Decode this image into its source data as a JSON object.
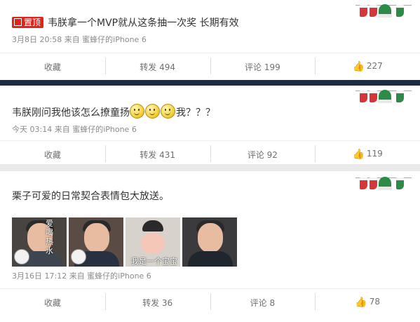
{
  "posts": [
    {
      "pinned_label": "置顶",
      "text": "韦朕拿一个MVP就从这条抽一次奖 长期有效",
      "meta": "3月8日 20:58 来自 蜜蜂仔的iPhone 6",
      "actions": {
        "favorite": "收藏",
        "repost": "转发 494",
        "comment": "评论 199",
        "like": "227"
      }
    },
    {
      "text_before": "韦朕刚问我他该怎么撩童扬",
      "text_after": "我？？？",
      "emoji_count": 3,
      "meta": "今天 03:14 来自 蜜蜂仔的iPhone 6",
      "actions": {
        "favorite": "收藏",
        "repost": "转发 431",
        "comment": "评论 92",
        "like": "119"
      }
    },
    {
      "text": "栗子可爱的日常契合表情包大放送。",
      "photo_captions": [
        "爱喝热水",
        "",
        "我是一个宝宝",
        ""
      ],
      "meta": "3月16日 17:12 来自 蜜蜂仔的iPhone 6",
      "actions": {
        "favorite": "收藏",
        "repost": "转发 36",
        "comment": "评论 8",
        "like": "78"
      }
    }
  ],
  "icons": {
    "like": "thumbs-up-icon",
    "decoration": "christmas-socks-hat-icon"
  },
  "colors": {
    "pin": "#e2231a",
    "text": "#333333",
    "meta": "#8a8a8a"
  }
}
